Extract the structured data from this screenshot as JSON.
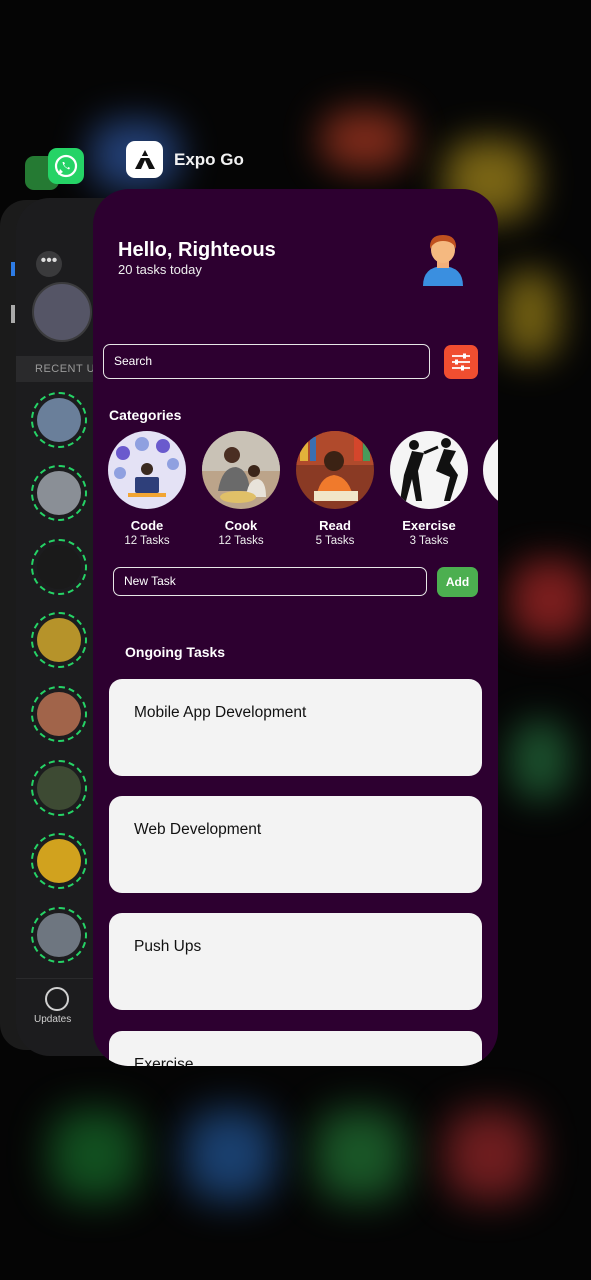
{
  "switcher": {
    "expo_app_name": "Expo Go",
    "whatsapp_icon": "whatsapp-icon",
    "messages_icon": "messages-icon"
  },
  "whatsapp": {
    "more_icon": "ellipsis-icon",
    "recent_header": "RECENT U",
    "updates_label": "Updates"
  },
  "app": {
    "greeting": "Hello, Righteous",
    "subtitle": "20 tasks today",
    "avatar_icon": "person-avatar-icon",
    "search_placeholder": "Search",
    "filter_icon": "sliders-icon",
    "filter_color": "#f04e30",
    "categories_title": "Categories",
    "categories": [
      {
        "name": "Code",
        "count": "12 Tasks"
      },
      {
        "name": "Cook",
        "count": "12 Tasks"
      },
      {
        "name": "Read",
        "count": "5 Tasks"
      },
      {
        "name": "Exercise",
        "count": "3 Tasks"
      }
    ],
    "new_task_placeholder": "New Task",
    "add_label": "Add",
    "add_color": "#4caf50",
    "ongoing_title": "Ongoing Tasks",
    "tasks": [
      "Mobile App Development",
      "Web Development",
      "Push Ups",
      "Exercise"
    ],
    "background_color": "#2d0030"
  }
}
